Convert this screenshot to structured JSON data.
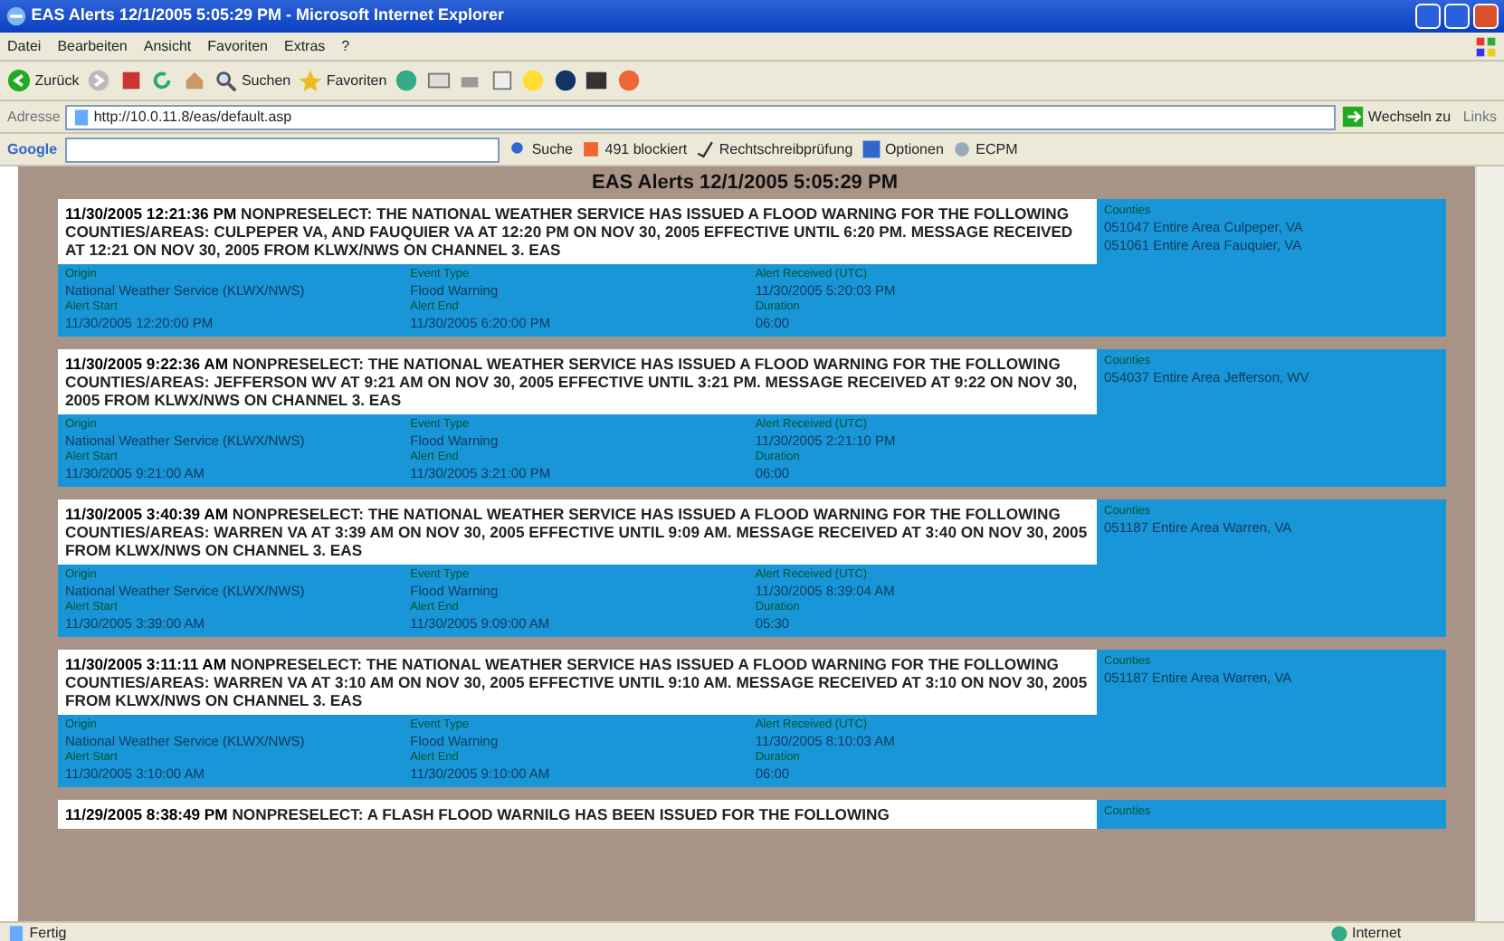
{
  "window": {
    "title": "EAS Alerts 12/1/2005 5:05:29 PM - Microsoft Internet Explorer"
  },
  "menu": [
    "Datei",
    "Bearbeiten",
    "Ansicht",
    "Favoriten",
    "Extras",
    "?"
  ],
  "toolbar": {
    "back": "Zurück",
    "search": "Suchen",
    "favorites": "Favoriten"
  },
  "address_bar": {
    "label": "Adresse",
    "url": "http://10.0.11.8/eas/default.asp",
    "go": "Wechseln zu",
    "links": "Links"
  },
  "google_toolbar": {
    "brand": "Google",
    "search": "Suche",
    "blocked": "491 blockiert",
    "spelling": "Rechtschreibprüfung",
    "options": "Optionen",
    "extra": "ECPM"
  },
  "page": {
    "heading": "EAS Alerts 12/1/2005 5:05:29 PM",
    "alerts": [
      {
        "timestamp": "11/30/2005 12:21:36 PM",
        "message": "NONPRESELECT: THE NATIONAL WEATHER SERVICE HAS ISSUED A FLOOD WARNING FOR THE FOLLOWING COUNTIES/AREAS: CULPEPER VA, AND FAUQUIER VA AT 12:20 PM ON NOV 30, 2005 EFFECTIVE UNTIL 6:20 PM. MESSAGE RECEIVED AT 12:21 ON NOV 30, 2005 FROM KLWX/NWS ON CHANNEL 3. EAS",
        "fields": [
          {
            "label": "Origin",
            "value": "National Weather Service (KLWX/NWS)"
          },
          {
            "label": "Event Type",
            "value": "Flood Warning"
          },
          {
            "label": "Alert Received (UTC)",
            "value": "11/30/2005 5:20:03 PM"
          },
          {
            "label": "Alert Start",
            "value": "11/30/2005 12:20:00 PM"
          },
          {
            "label": "Alert End",
            "value": "11/30/2005 6:20:00 PM"
          },
          {
            "label": "Duration",
            "value": "06:00"
          }
        ],
        "counties_label": "Counties",
        "counties": [
          "051047 Entire Area Culpeper, VA",
          "051061 Entire Area Fauquier, VA"
        ]
      },
      {
        "timestamp": "11/30/2005 9:22:36 AM",
        "message": "NONPRESELECT: THE NATIONAL WEATHER SERVICE HAS ISSUED A FLOOD WARNING FOR THE FOLLOWING COUNTIES/AREAS: JEFFERSON WV AT 9:21 AM ON NOV 30, 2005 EFFECTIVE UNTIL 3:21 PM. MESSAGE RECEIVED AT 9:22 ON NOV 30, 2005 FROM KLWX/NWS ON CHANNEL 3. EAS",
        "fields": [
          {
            "label": "Origin",
            "value": "National Weather Service (KLWX/NWS)"
          },
          {
            "label": "Event Type",
            "value": "Flood Warning"
          },
          {
            "label": "Alert Received (UTC)",
            "value": "11/30/2005 2:21:10 PM"
          },
          {
            "label": "Alert Start",
            "value": "11/30/2005 9:21:00 AM"
          },
          {
            "label": "Alert End",
            "value": "11/30/2005 3:21:00 PM"
          },
          {
            "label": "Duration",
            "value": "06:00"
          }
        ],
        "counties_label": "Counties",
        "counties": [
          "054037 Entire Area Jefferson, WV"
        ]
      },
      {
        "timestamp": "11/30/2005 3:40:39 AM",
        "message": "NONPRESELECT: THE NATIONAL WEATHER SERVICE HAS ISSUED A FLOOD WARNING FOR THE FOLLOWING COUNTIES/AREAS: WARREN VA AT 3:39 AM ON NOV 30, 2005 EFFECTIVE UNTIL 9:09 AM. MESSAGE RECEIVED AT 3:40 ON NOV 30, 2005 FROM KLWX/NWS ON CHANNEL 3. EAS",
        "fields": [
          {
            "label": "Origin",
            "value": "National Weather Service (KLWX/NWS)"
          },
          {
            "label": "Event Type",
            "value": "Flood Warning"
          },
          {
            "label": "Alert Received (UTC)",
            "value": "11/30/2005 8:39:04 AM"
          },
          {
            "label": "Alert Start",
            "value": "11/30/2005 3:39:00 AM"
          },
          {
            "label": "Alert End",
            "value": "11/30/2005 9:09:00 AM"
          },
          {
            "label": "Duration",
            "value": "05:30"
          }
        ],
        "counties_label": "Counties",
        "counties": [
          "051187 Entire Area Warren, VA"
        ]
      },
      {
        "timestamp": "11/30/2005 3:11:11 AM",
        "message": "NONPRESELECT: THE NATIONAL WEATHER SERVICE HAS ISSUED A FLOOD WARNING FOR THE FOLLOWING COUNTIES/AREAS: WARREN VA AT 3:10 AM ON NOV 30, 2005 EFFECTIVE UNTIL 9:10 AM. MESSAGE RECEIVED AT 3:10 ON NOV 30, 2005 FROM KLWX/NWS ON CHANNEL 3. EAS",
        "fields": [
          {
            "label": "Origin",
            "value": "National Weather Service (KLWX/NWS)"
          },
          {
            "label": "Event Type",
            "value": "Flood Warning"
          },
          {
            "label": "Alert Received (UTC)",
            "value": "11/30/2005 8:10:03 AM"
          },
          {
            "label": "Alert Start",
            "value": "11/30/2005 3:10:00 AM"
          },
          {
            "label": "Alert End",
            "value": "11/30/2005 9:10:00 AM"
          },
          {
            "label": "Duration",
            "value": "06:00"
          }
        ],
        "counties_label": "Counties",
        "counties": [
          "051187 Entire Area Warren, VA"
        ]
      },
      {
        "timestamp": "11/29/2005 8:38:49 PM",
        "message": "NONPRESELECT: A FLASH FLOOD WARNILG HAS BEEN ISSUED FOR THE FOLLOWING",
        "counties_label": "Counties"
      }
    ]
  },
  "status_bar": {
    "text": "Fertig",
    "zone": "Internet"
  }
}
